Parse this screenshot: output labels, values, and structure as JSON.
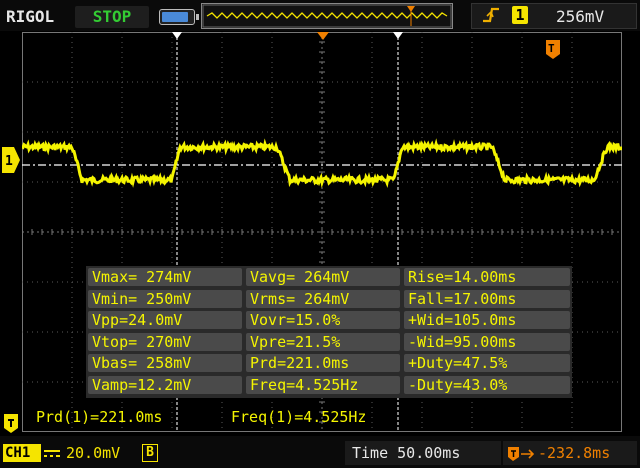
{
  "header": {
    "brand": "RIGOL",
    "run_status": "STOP",
    "trigger_source": "1",
    "trigger_level": "256mV",
    "marker_T": "T"
  },
  "measurements": {
    "rows": [
      [
        "Vmax= 274mV",
        "Vavg= 264mV",
        "Rise=14.00ms"
      ],
      [
        "Vmin= 250mV",
        "Vrms= 264mV",
        "Fall=17.00ms"
      ],
      [
        "Vpp=24.0mV",
        "Vovr=15.0%",
        "+Wid=105.0ms"
      ],
      [
        "Vtop= 270mV",
        "Vpre=21.5%",
        "-Wid=95.00ms"
      ],
      [
        "Vbas= 258mV",
        "Prd=221.0ms",
        "+Duty=47.5%"
      ],
      [
        "Vamp=12.2mV",
        "Freq=4.525Hz",
        "-Duty=43.0%"
      ]
    ],
    "bottom_period": "Prd(1)=221.0ms",
    "bottom_freq": "Freq(1)=4.525Hz"
  },
  "footer": {
    "channel": "CH1",
    "scale": "20.0mV",
    "bw_limit": "B",
    "timebase": "Time 50.00ms",
    "trigger_offset": "-232.8ms"
  },
  "colors": {
    "trace": "#f5f500",
    "trigger": "#f08000",
    "grid": "#5a5a5a",
    "stop": "#33cc33"
  },
  "icons": [
    "battery-icon",
    "rising-edge-icon",
    "trigger-marker-icon",
    "channel-ground-marker-icon",
    "bandwidth-limit-icon"
  ]
}
